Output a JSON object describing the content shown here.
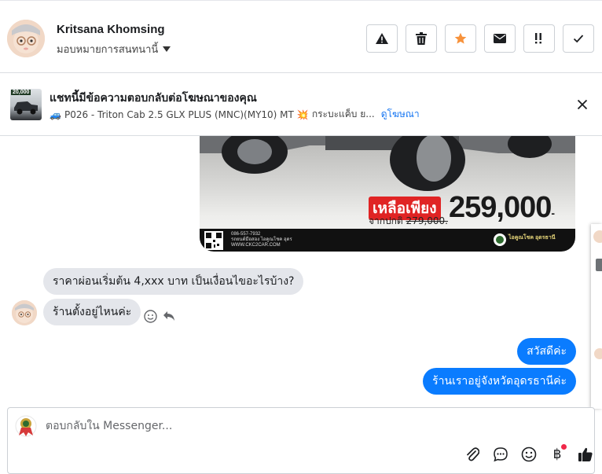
{
  "header": {
    "contact_name": "Kritsana Khomsing",
    "assign_label": "มอบหมายการสนทนานี้",
    "tools": [
      {
        "name": "spam-icon",
        "label": "!"
      },
      {
        "name": "trash-icon",
        "label": ""
      },
      {
        "name": "star-icon",
        "label": ""
      },
      {
        "name": "envelope-icon",
        "label": ""
      },
      {
        "name": "follow-up-icon",
        "label": "!!"
      },
      {
        "name": "check-icon",
        "label": ""
      }
    ],
    "star_color": "#f7923b"
  },
  "ad_context": {
    "title": "แชทนี้มีข้อความตอบกลับต่อโฆษณาของคุณ",
    "thumb_tag": "20,000",
    "truck_emoji": "🚙",
    "description": "P026 - Triton Cab 2.5 GLX PLUS (MNC)(MY10) MT",
    "burst_emoji": "💥",
    "description_more": "กระบะแค็บ ย...",
    "link_label": "ดูโฆษณา",
    "link_color": "#1877f2"
  },
  "ad_image": {
    "remain_label": "เหลือเพียง",
    "normal_label": "จากปกติ",
    "old_price": "279,000.",
    "new_price": "259,000",
    "currency_mark": "-",
    "footer_lines": [
      "086-557-7932",
      "รถยนต์มือสอง ไอคูณโชค อุดร",
      "WWW.CKC2CAR.COM"
    ],
    "logo_text": "ไอคูณโชค อุดรธานี"
  },
  "messages": {
    "incoming": [
      "ราคาผ่อนเริ่มต้น 4,xxx บาท เป็นเงื่อนไขอะไรบ้าง?",
      "ร้านตั้งอยู่ไหนค่ะ"
    ],
    "outgoing": [
      "สวัสดีค่ะ",
      "ร้านเราอยู่จังหวัดอุดรธานีค่ะ"
    ],
    "bubble_out_color": "#0a7cff",
    "bubble_in_color": "#e4e6eb"
  },
  "composer": {
    "placeholder": "ตอบกลับใน Messenger...",
    "currency_symbol": "฿",
    "tools": [
      "paperclip-icon",
      "saved-reply-icon",
      "emoji-icon",
      "payment-icon",
      "thumbs-up-icon"
    ]
  }
}
